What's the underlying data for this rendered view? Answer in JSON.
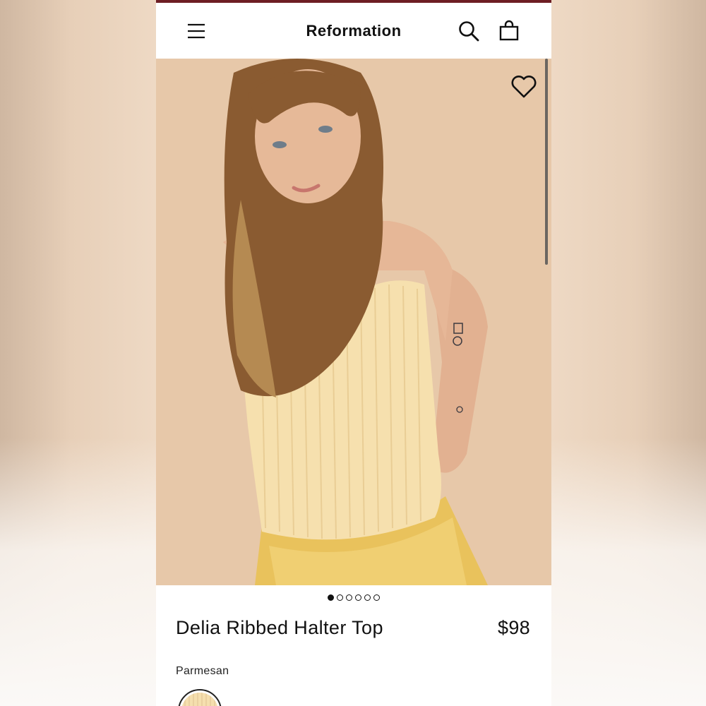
{
  "header": {
    "brand": "Reformation",
    "menu_icon": "menu-icon",
    "search_icon": "search-icon",
    "bag_icon": "shopping-bag-icon"
  },
  "gallery": {
    "heart_icon": "heart-icon",
    "image_count": 6,
    "active_index": 0
  },
  "product": {
    "title": "Delia Ribbed Halter Top",
    "price": "$98",
    "color_name": "Parmesan"
  },
  "colors": {
    "brand_strip": "#6e1e24",
    "swatch": "#f5dfae",
    "text": "#111111"
  }
}
